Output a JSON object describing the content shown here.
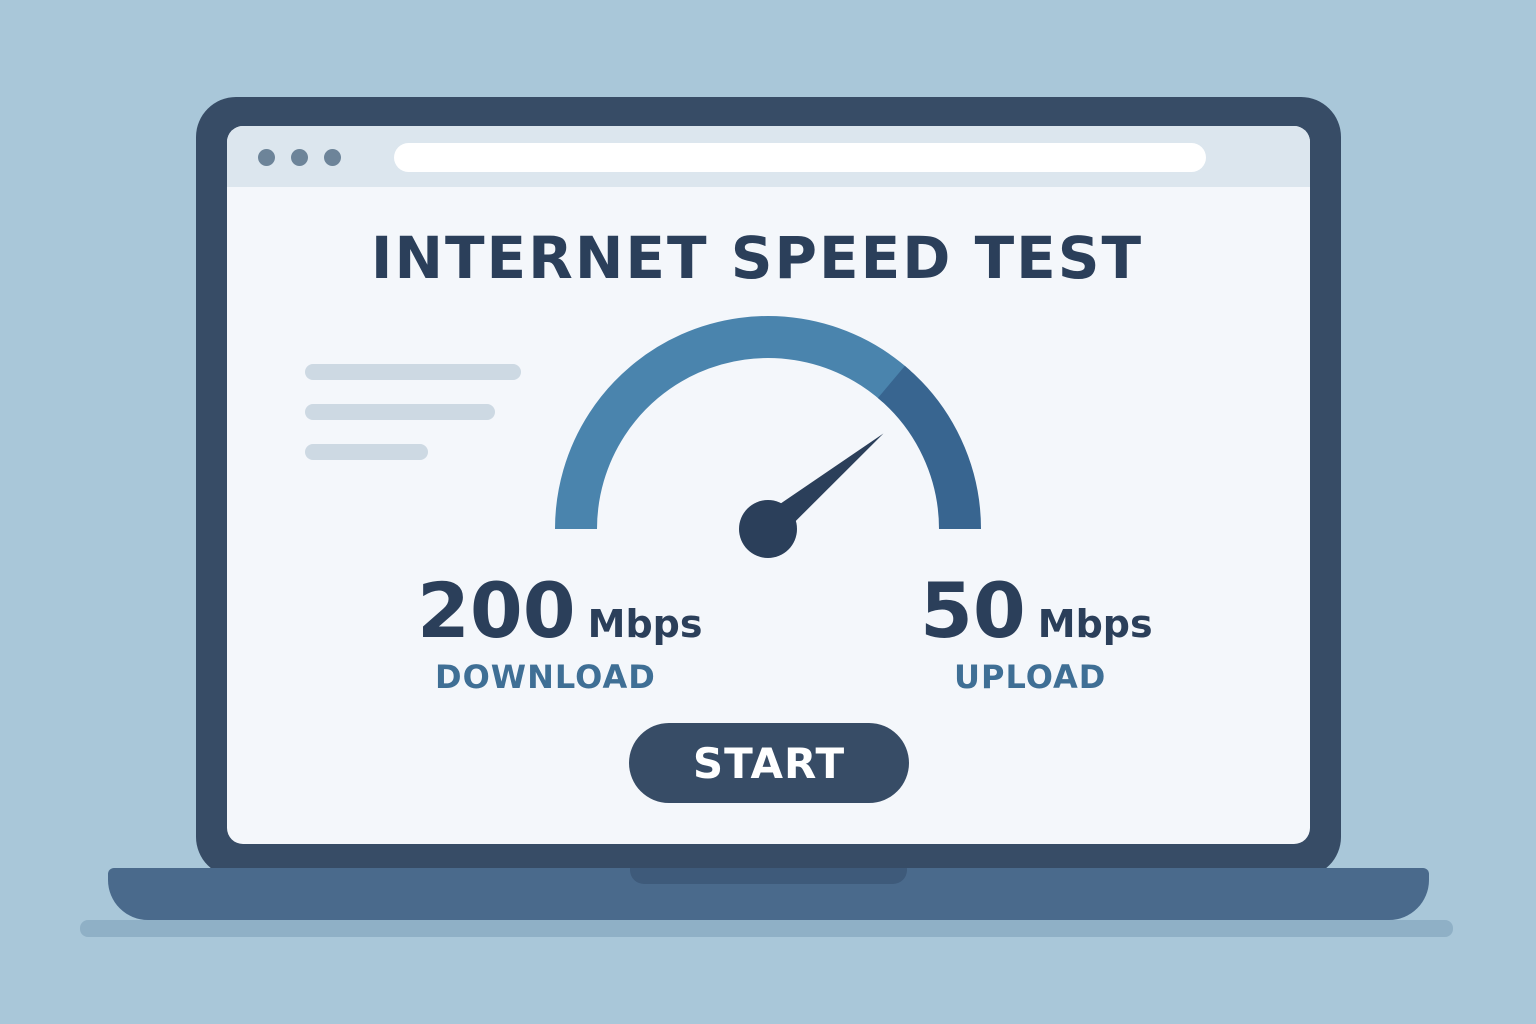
{
  "page": {
    "title": "INTERNET SPEED TEST"
  },
  "gauge": {
    "needle_level": 0.78,
    "colors": {
      "arc_main": "#4a84ad",
      "arc_end": "#386590",
      "needle": "#2b3f5a"
    }
  },
  "download": {
    "value": "200",
    "unit": "Mbps",
    "label": "DOWNLOAD"
  },
  "upload": {
    "value": "50",
    "unit": "Mbps",
    "label": "UPLOAD"
  },
  "start_button": {
    "label": "START"
  },
  "colors": {
    "background": "#a9c7d9",
    "laptop_frame": "#374c66",
    "screen": "#f4f7fb",
    "text_dark": "#2b3f5a",
    "text_accent": "#3f6f95"
  },
  "icons": {
    "browser_dots": "window-control-dots-icon",
    "gauge": "speedometer-icon"
  }
}
